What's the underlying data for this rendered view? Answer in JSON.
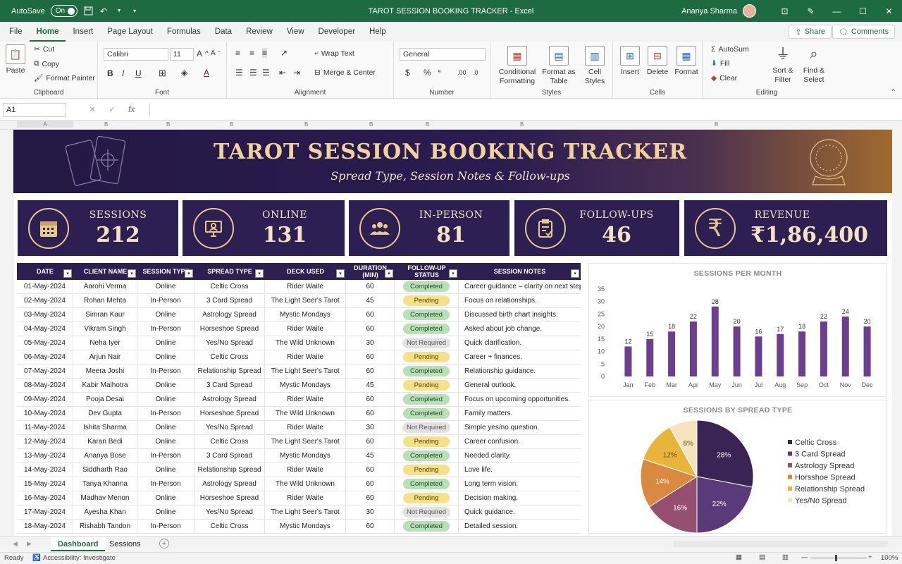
{
  "window": {
    "autosave_label": "AutoSave",
    "autosave_state": "On",
    "title": "TAROT SESSION BOOKING TRACKER - Excel",
    "user": "Ananya Sharma"
  },
  "menu": [
    "File",
    "Home",
    "Insert",
    "Page Layout",
    "Formulas",
    "Data",
    "Review",
    "View",
    "Developer",
    "Help"
  ],
  "share_label": "Share",
  "comments_label": "Comments",
  "ribbon": {
    "paste": "Paste",
    "cut": "Cut",
    "copy": "Copy",
    "format_painter": "Format Painter",
    "clipboard": "Clipboard",
    "font_name": "Calibri",
    "font_size": "11",
    "font": "Font",
    "wrap_text": "Wrap Text",
    "merge_center": "Merge & Center",
    "alignment": "Alignment",
    "number_format": "General",
    "number": "Number",
    "conditional_formatting": "Conditional Formatting",
    "format_as_table": "Format as Table",
    "cell_styles": "Cell Styles",
    "styles": "Styles",
    "insert": "Insert",
    "delete": "Delete",
    "format": "Format",
    "cells": "Cells",
    "autosum": "AutoSum",
    "fill": "Fill",
    "clear": "Clear",
    "sort_filter": "Sort & Filter",
    "find_select": "Find & Select",
    "editing": "Editing"
  },
  "formula_bar": {
    "name_box": "A1",
    "fx": "fx"
  },
  "columns": [
    "A",
    "B",
    "B",
    "B",
    "B",
    "B",
    "B",
    "B",
    "B"
  ],
  "banner": {
    "title": "TAROT SESSION BOOKING TRACKER",
    "subtitle": "Spread Type, Session Notes & Follow-ups"
  },
  "kpis": [
    {
      "label": "SESSIONS",
      "value": "212",
      "icon": "calendar-icon"
    },
    {
      "label": "ONLINE",
      "value": "131",
      "icon": "monitor-user-icon"
    },
    {
      "label": "IN-PERSON",
      "value": "81",
      "icon": "group-icon"
    },
    {
      "label": "FOLLOW-UPS",
      "value": "46",
      "icon": "clipboard-check-icon"
    },
    {
      "label": "REVENUE",
      "value": "₹1,86,400",
      "icon": "rupee-icon"
    }
  ],
  "table": {
    "headers": [
      "DATE",
      "CLIENT NAME",
      "SESSION TYPE",
      "SPREAD TYPE",
      "DECK USED",
      "DURATION (MIN)",
      "FOLLOW-UP STATUS",
      "SESSION NOTES"
    ],
    "rows": [
      [
        "01-May-2024",
        "Aarohi Verma",
        "Online",
        "Celtic Cross",
        "Rider Waite",
        "60",
        "Completed",
        "Career guidance – clarity on next steps."
      ],
      [
        "02-May-2024",
        "Rohan Mehta",
        "In-Person",
        "3 Card Spread",
        "The Light Seer's Tarot",
        "45",
        "Pending",
        "Focus on relationships."
      ],
      [
        "03-May-2024",
        "Simran Kaur",
        "Online",
        "Astrology Spread",
        "Mystic Mondays",
        "60",
        "Completed",
        "Discussed birth chart insights."
      ],
      [
        "04-May-2024",
        "Vikram Singh",
        "In-Person",
        "Horseshoe Spread",
        "Rider Waite",
        "60",
        "Completed",
        "Asked about job change."
      ],
      [
        "05-May-2024",
        "Neha Iyer",
        "Online",
        "Yes/No Spread",
        "The Wild Unknown",
        "30",
        "Not Required",
        "Quick clarification."
      ],
      [
        "06-May-2024",
        "Arjun Nair",
        "Online",
        "Celtic Cross",
        "Rider Waite",
        "60",
        "Pending",
        "Career + finances."
      ],
      [
        "07-May-2024",
        "Meera Joshi",
        "In-Person",
        "Relationship Spread",
        "The Light Seer's Tarot",
        "60",
        "Completed",
        "Relationship guidance."
      ],
      [
        "08-May-2024",
        "Kabir Malhotra",
        "Online",
        "3 Card Spread",
        "Mystic Mondays",
        "45",
        "Pending",
        "General outlook."
      ],
      [
        "09-May-2024",
        "Pooja Desai",
        "Online",
        "Astrology Spread",
        "Rider Waite",
        "60",
        "Completed",
        "Focus on upcoming opportunities."
      ],
      [
        "10-May-2024",
        "Dev Gupta",
        "In-Person",
        "Horseshoe Spread",
        "The Wild Unknown",
        "60",
        "Completed",
        "Family matters."
      ],
      [
        "11-May-2024",
        "Ishita Sharma",
        "Online",
        "Yes/No Spread",
        "Rider Waite",
        "30",
        "Not Required",
        "Simple yes/no question."
      ],
      [
        "12-May-2024",
        "Karan Bedi",
        "Online",
        "Celtic Cross",
        "The Light Seer's Tarot",
        "60",
        "Pending",
        "Career confusion."
      ],
      [
        "13-May-2024",
        "Ananya Bose",
        "In-Person",
        "3 Card Spread",
        "Mystic Mondays",
        "45",
        "Completed",
        "Needed clarity."
      ],
      [
        "14-May-2024",
        "Siddharth Rao",
        "Online",
        "Relationship Spread",
        "Rider Waite",
        "60",
        "Pending",
        "Love life."
      ],
      [
        "15-May-2024",
        "Tanya Khanna",
        "In-Person",
        "Astrology Spread",
        "The Wild Unknown",
        "60",
        "Completed",
        "Long term vision."
      ],
      [
        "16-May-2024",
        "Madhav Menon",
        "Online",
        "Horseshoe Spread",
        "Rider Waite",
        "60",
        "Pending",
        "Decision making."
      ],
      [
        "17-May-2024",
        "Ayesha Khan",
        "Online",
        "Yes/No Spread",
        "The Light Seer's Tarot",
        "30",
        "Not Required",
        "Quick guidance."
      ],
      [
        "18-May-2024",
        "Rishabh Tandon",
        "In-Person",
        "Celtic Cross",
        "Mystic Mondays",
        "60",
        "Completed",
        "Detailed session."
      ]
    ]
  },
  "chart_data": [
    {
      "type": "bar",
      "title": "SESSIONS PER MONTH",
      "categories": [
        "Jan",
        "Feb",
        "Mar",
        "Apr",
        "May",
        "Jun",
        "Jul",
        "Aug",
        "Sep",
        "Oct",
        "Nov",
        "Dec"
      ],
      "values": [
        12,
        15,
        18,
        22,
        28,
        20,
        16,
        17,
        18,
        22,
        24,
        20
      ],
      "ylim": [
        0,
        35
      ],
      "yticks": [
        0,
        5,
        10,
        15,
        20,
        25,
        30,
        35
      ],
      "color": "#6b3f8e",
      "grid": false
    },
    {
      "type": "pie",
      "title": "SESSIONS BY SPREAD TYPE",
      "labels": [
        "Celtic Cross",
        "3 Card Spread",
        "Astrology Spread",
        "Horsshoe Spread",
        "Relationship Spread",
        "Yes/No Spread"
      ],
      "values": [
        28,
        22,
        16,
        14,
        12,
        8
      ],
      "colors": [
        "#3a2456",
        "#5b3a7a",
        "#94506e",
        "#d98940",
        "#e8b43a",
        "#f7e4bd"
      ],
      "legend": "right"
    }
  ],
  "sheets": [
    "Dashboard",
    "Sessions"
  ],
  "status": {
    "ready": "Ready",
    "accessibility": "Accessibility: Investigate",
    "zoom": "100%"
  }
}
